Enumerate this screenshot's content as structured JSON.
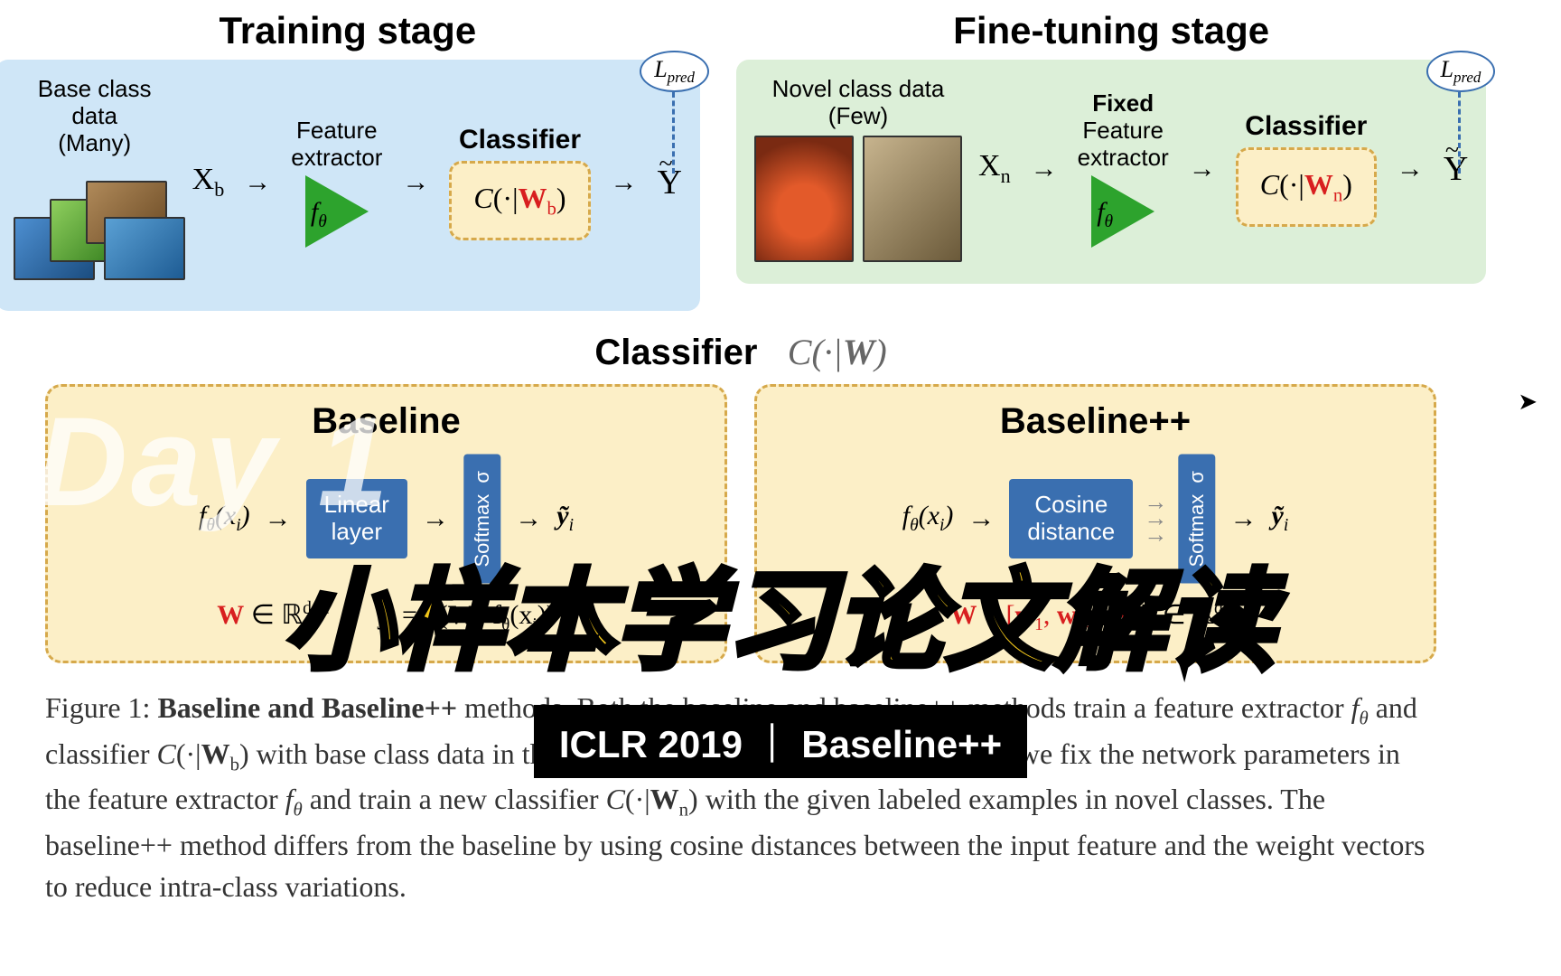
{
  "stages": {
    "training": {
      "title": "Training stage",
      "data_label_l1": "Base class data",
      "data_label_l2": "(Many)",
      "x_var": "X_b",
      "fe_label_l1": "Feature",
      "fe_label_l2": "extractor",
      "fe_sym": "f_θ",
      "classifier_label": "Classifier",
      "classifier_expr": "C(·|W_b)",
      "y_out": "Ŷ",
      "l_pred": "L_pred"
    },
    "finetune": {
      "title": "Fine-tuning stage",
      "data_label_l1": "Novel class data",
      "data_label_l2": "(Few)",
      "x_var": "X_n",
      "fe_label_l1": "Fixed",
      "fe_label_l2": "Feature",
      "fe_label_l3": "extractor",
      "fe_sym": "f_θ",
      "classifier_label": "Classifier",
      "classifier_expr": "C(·|W_n)",
      "y_out": "Ŷ",
      "l_pred": "L_pred"
    }
  },
  "classifier_caption": {
    "label": "Classifier",
    "expr": "C(·|W)"
  },
  "methods": {
    "baseline": {
      "title": "Baseline",
      "input_expr": "f_θ(x_i)",
      "block1": "Linear\nlayer",
      "block2_a": "Softmax",
      "block2_b": "σ",
      "output_expr": "ỹ_i",
      "formula_left": "W ∈ ℝ^{d×c}",
      "formula_right": "ỹ_i = σ(W^T f_θ(x_i))"
    },
    "baselinepp": {
      "title": "Baseline++",
      "input_expr": "f_θ(x_i)",
      "block1": "Cosine\ndistance",
      "block2_a": "Softmax",
      "block2_b": "σ",
      "output_expr": "ỹ_i",
      "formula_w": "W = [w_1, w_2, ...w_c]",
      "formula_dim": " ∈ ℝ^{d×c}"
    }
  },
  "figure_caption": {
    "lead": "Figure 1:",
    "line1a": "Baseline and Baseline++ methods. Both the baseline and",
    "line2": "baseline++ methods train a feature extractor f_θ and classifier C(·|W_b) with base class data in the",
    "line3": "training stage. In the fine-tuning stage, we fix the network parameters in the feature extractor f_θ",
    "line4": "and train a new classifier C(·|W_n) with the given labeled examples in novel classes. The",
    "line5": "baseline++ method differs from the baseline by using cosine distances between the input",
    "line6": "feature and the weight vectors to reduce intra-class variations."
  },
  "overlays": {
    "day_watermark": "Day 1",
    "main_title": "小样本学习论文解读",
    "badge": "ICLR 2019 ｜ Baseline++"
  },
  "cursor": "➤"
}
